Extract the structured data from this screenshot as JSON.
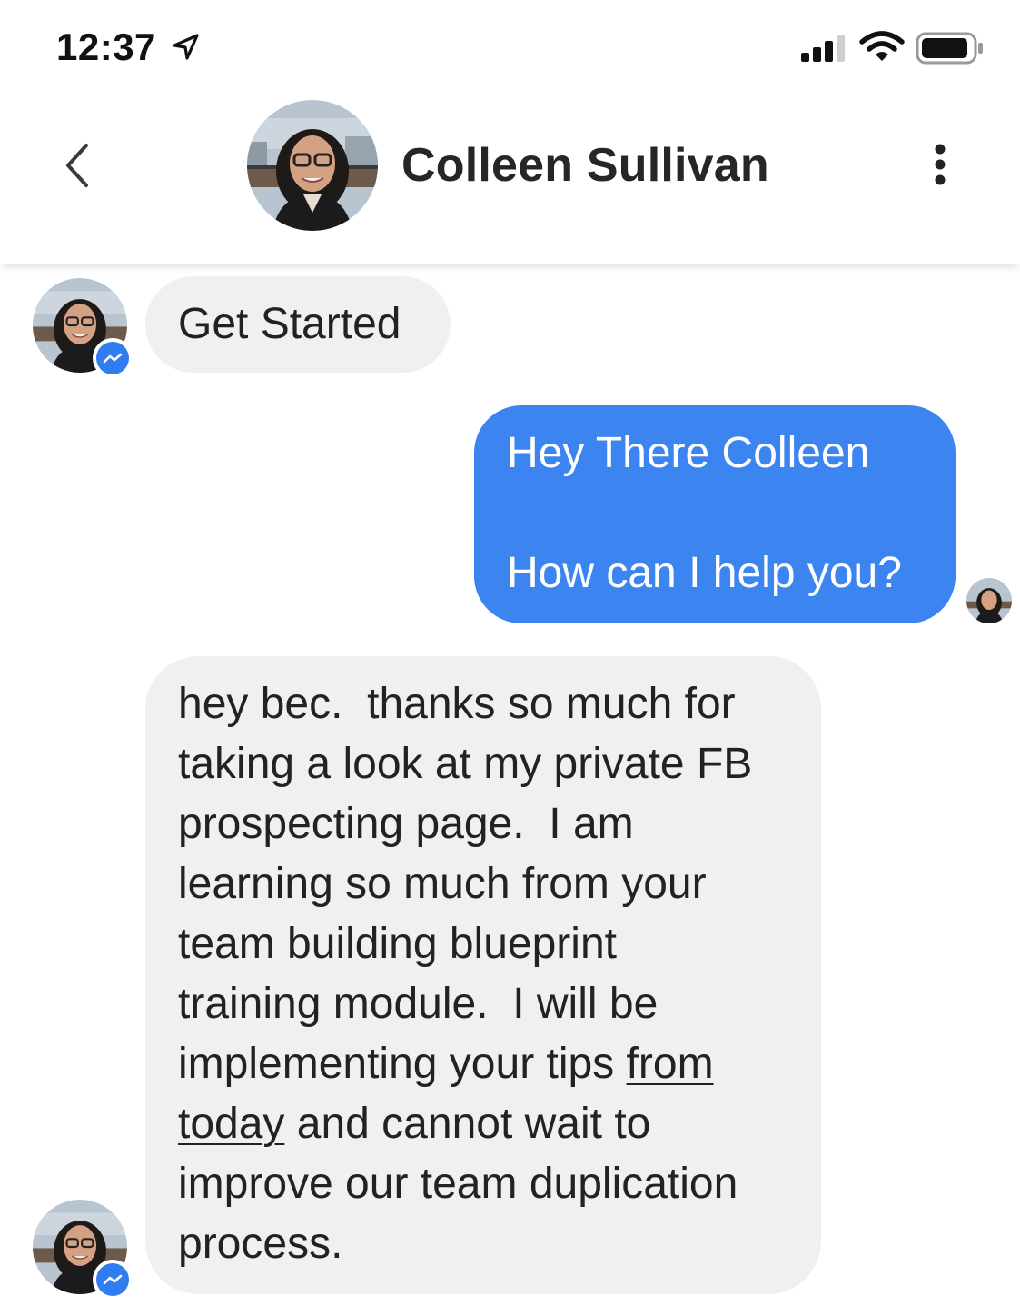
{
  "status_bar": {
    "time": "12:37",
    "icons": [
      "location-arrow-icon",
      "cellular-signal-icon",
      "wifi-icon",
      "battery-icon"
    ]
  },
  "header": {
    "back_icon": "chevron-left-icon",
    "contact_name": "Colleen Sullivan",
    "more_icon": "vertical-ellipsis-icon"
  },
  "messages": [
    {
      "direction": "incoming",
      "text": "Get Started"
    },
    {
      "direction": "outgoing",
      "lines": [
        "Hey There Colleen",
        "",
        "How can I help you?"
      ]
    },
    {
      "direction": "incoming",
      "lines": [
        "hey bec.  thanks so much for",
        "taking a look at my private FB",
        "prospecting page.  I am",
        "learning so much from your",
        "team building blueprint",
        "training module.  I will be",
        "implementing your tips ",
        "from",
        "today",
        " and cannot wait to",
        "improve our team duplication",
        "process."
      ]
    }
  ],
  "colors": {
    "incoming_bubble": "#f0f0f0",
    "outgoing_bubble": "#3c84f0",
    "messenger_badge": "#2f7df0"
  }
}
